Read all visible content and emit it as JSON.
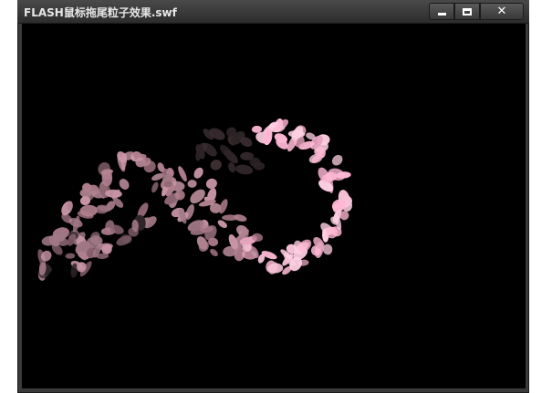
{
  "window": {
    "title": "FLASH鼠标拖尾粒子效果.swf",
    "minimize_icon": "minimize-icon",
    "maximize_icon": "maximize-icon",
    "close_icon": "close-icon"
  },
  "colors": {
    "background": "#000000",
    "petal_bright": "#ffb6d2",
    "petal_dim": "#a8707e",
    "petal_faded": "#3a2a2e"
  }
}
